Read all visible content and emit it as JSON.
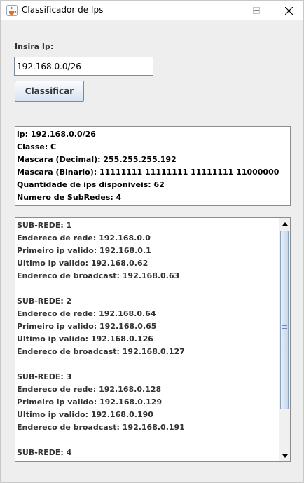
{
  "window": {
    "title": "Classificador de Ips",
    "icon": "java-cup-icon"
  },
  "form": {
    "ip_label": "Insira Ip:",
    "ip_value": "192.168.0.0/26",
    "classify_label": "Classificar"
  },
  "info": {
    "lines": [
      "ip: 192.168.0.0/26",
      "Classe: C",
      "Mascara (Decimal): 255.255.255.192",
      "Mascara (Binario): 11111111 11111111 11111111 11000000",
      "Quantidade de ips disponiveis: 62",
      "Numero de SubRedes: 4"
    ]
  },
  "subnets": [
    {
      "header": "SUB-REDE: 1",
      "network": "Endereco de rede: 192.168.0.0",
      "first": "Primeiro ip valido: 192.168.0.1",
      "last": "Ultimo ip valido: 192.168.0.62",
      "broadcast": "Endereco de broadcast: 192.168.0.63"
    },
    {
      "header": "SUB-REDE: 2",
      "network": "Endereco de rede: 192.168.0.64",
      "first": "Primeiro ip valido: 192.168.0.65",
      "last": "Ultimo ip valido: 192.168.0.126",
      "broadcast": "Endereco de broadcast: 192.168.0.127"
    },
    {
      "header": "SUB-REDE: 3",
      "network": "Endereco de rede: 192.168.0.128",
      "first": "Primeiro ip valido: 192.168.0.129",
      "last": "Ultimo ip valido: 192.168.0.190",
      "broadcast": "Endereco de broadcast: 192.168.0.191"
    },
    {
      "header": "SUB-REDE: 4"
    }
  ]
}
